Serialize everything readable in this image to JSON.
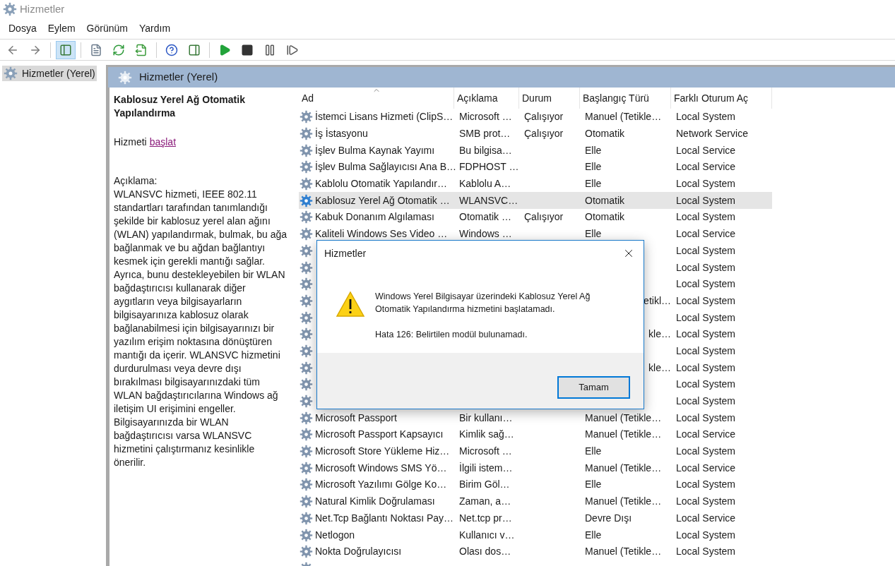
{
  "window": {
    "title": "Hizmetler"
  },
  "menu": [
    "Dosya",
    "Eylem",
    "Görünüm",
    "Yardım"
  ],
  "toolbar": [
    {
      "kind": "back",
      "selected": false
    },
    {
      "kind": "forward",
      "selected": false
    },
    {
      "kind": "sep"
    },
    {
      "kind": "tree",
      "selected": true
    },
    {
      "kind": "sep"
    },
    {
      "kind": "properties",
      "selected": false
    },
    {
      "kind": "refresh",
      "selected": false
    },
    {
      "kind": "export",
      "selected": false
    },
    {
      "kind": "sep"
    },
    {
      "kind": "help",
      "selected": false
    },
    {
      "kind": "actionpane",
      "selected": false
    },
    {
      "kind": "sep"
    },
    {
      "kind": "start",
      "selected": false
    },
    {
      "kind": "stop",
      "selected": false
    },
    {
      "kind": "pause",
      "selected": false
    },
    {
      "kind": "resume",
      "selected": false
    }
  ],
  "tree": {
    "items": [
      {
        "label": "Hizmetler (Yerel)",
        "selected": true
      }
    ]
  },
  "pane": {
    "title": "Hizmetler (Yerel)"
  },
  "details": {
    "service_name": "Kablosuz Yerel Ağ Otomatik Yapılandırma",
    "action_prefix": "Hizmeti",
    "action_link": "başlat",
    "description_label": "Açıklama:",
    "description": "WLANSVC hizmeti, IEEE 802.11 standartları tarafından tanımlandığı şekilde bir kablosuz yerel alan ağını (WLAN) yapılandırmak, bulmak, bu ağa bağlanmak ve bu ağdan bağlantıyı kesmek için gerekli mantığı sağlar. Ayrıca, bunu destekleyebilen bir WLAN bağdaştırıcısı kullanarak diğer aygıtların veya bilgisayarların bilgisayarınıza kablosuz olarak bağlanabilmesi için bilgisayarınızı bir yazılım erişim noktasına dönüştüren mantığı da içerir. WLANSVC hizmetini durdurulması veya devre dışı bırakılması bilgisayarınızdaki tüm WLAN bağdaştırıcılarına Windows ağ iletişim UI erişimini engeller. Bilgisayarınızda bir WLAN bağdaştırıcısı varsa WLANSVC hizmetini çalıştırmanız kesinlikle önerilir."
  },
  "table": {
    "columns": [
      {
        "label": "Ad",
        "sorted": true
      },
      {
        "label": "Açıklama",
        "sorted": false
      },
      {
        "label": "Durum",
        "sorted": false
      },
      {
        "label": "Başlangıç Türü",
        "sorted": false
      },
      {
        "label": "Farklı Oturum Aç",
        "sorted": false
      }
    ],
    "rows": [
      {
        "name": "İstemci Lisans Hizmeti (ClipS…",
        "description": "Microsoft …",
        "status": "Çalışıyor",
        "startup": "Manuel (Tetikle…",
        "logon": "Local System",
        "selected": false
      },
      {
        "name": "İş İstasyonu",
        "description": "SMB prot…",
        "status": "Çalışıyor",
        "startup": "Otomatik",
        "logon": "Network Service",
        "selected": false
      },
      {
        "name": "İşlev Bulma Kaynak Yayımı",
        "description": "Bu bilgisa…",
        "startup": "Elle",
        "logon": "Local Service",
        "selected": false
      },
      {
        "name": "İşlev Bulma Sağlayıcısı Ana B…",
        "description": "FDPHOST …",
        "startup": "Elle",
        "logon": "Local Service",
        "selected": false
      },
      {
        "name": "Kablolu Otomatik Yapılandır…",
        "description": "Kablolu A…",
        "startup": "Elle",
        "logon": "Local System",
        "selected": false
      },
      {
        "name": "Kablosuz Yerel Ağ Otomatik …",
        "description": "WLANSVC…",
        "startup": "Otomatik",
        "logon": "Local System",
        "selected": true
      },
      {
        "name": "Kabuk Donanım Algılaması",
        "description": "Otomatik …",
        "status": "Çalışıyor",
        "startup": "Otomatik",
        "logon": "Local System",
        "selected": false
      },
      {
        "name": "Kaliteli Windows Ses Video …",
        "description": "Windows …",
        "startup": "Elle",
        "logon": "Local Service",
        "selected": false
      },
      {
        "logon": "Local System",
        "selected": false
      },
      {
        "logon": "Local System",
        "selected": false
      },
      {
        "logon": "Local System",
        "selected": false
      },
      {
        "startup": "etikl…",
        "logon": "Local System",
        "selected": false
      },
      {
        "logon": "Local System",
        "selected": false
      },
      {
        "startup": "kle…",
        "logon": "Local System",
        "selected": false
      },
      {
        "logon": "Local System",
        "selected": false
      },
      {
        "startup": "kle…",
        "logon": "Local System",
        "selected": false
      },
      {
        "logon": "Local System",
        "selected": false
      },
      {
        "logon": "Local System",
        "selected": false
      },
      {
        "name": "Microsoft Passport",
        "description": "Bir kullanı…",
        "startup": "Manuel (Tetikle…",
        "logon": "Local System",
        "selected": false
      },
      {
        "name": "Microsoft Passport Kapsayıcı",
        "description": "Kimlik sağ…",
        "startup": "Manuel (Tetikle…",
        "logon": "Local Service",
        "selected": false
      },
      {
        "name": "Microsoft Store Yükleme Hiz…",
        "description": "Microsoft …",
        "startup": "Elle",
        "logon": "Local System",
        "selected": false
      },
      {
        "name": "Microsoft Windows SMS Yö…",
        "description": "İlgili istem…",
        "startup": "Manuel (Tetikle…",
        "logon": "Local Service",
        "selected": false
      },
      {
        "name": "Microsoft Yazılımı Gölge Ko…",
        "description": "Birim Göl…",
        "startup": "Elle",
        "logon": "Local System",
        "selected": false
      },
      {
        "name": "Natural Kimlik Doğrulaması",
        "description": "Zaman, a…",
        "startup": "Manuel (Tetikle…",
        "logon": "Local System",
        "selected": false
      },
      {
        "name": "Net.Tcp Bağlantı Noktası Pay…",
        "description": "Net.tcp pr…",
        "startup": "Devre Dışı",
        "logon": "Local Service",
        "selected": false
      },
      {
        "name": "Netlogon",
        "description": "Kullanıcı v…",
        "startup": "Elle",
        "logon": "Local System",
        "selected": false
      },
      {
        "name": "Nokta Doğrulayıcısı",
        "description": "Olası dos…",
        "startup": "Manuel (Tetikle…",
        "logon": "Local System",
        "selected": false
      },
      {
        "selected": false
      }
    ]
  },
  "dialog": {
    "title": "Hizmetler",
    "message": "Windows Yerel Bilgisayar üzerindeki Kablosuz Yerel Ağ Otomatik Yapılandırma hizmetini başlatamadı.",
    "error": "Hata 126: Belirtilen modül bulunamadı.",
    "button": "Tamam"
  }
}
